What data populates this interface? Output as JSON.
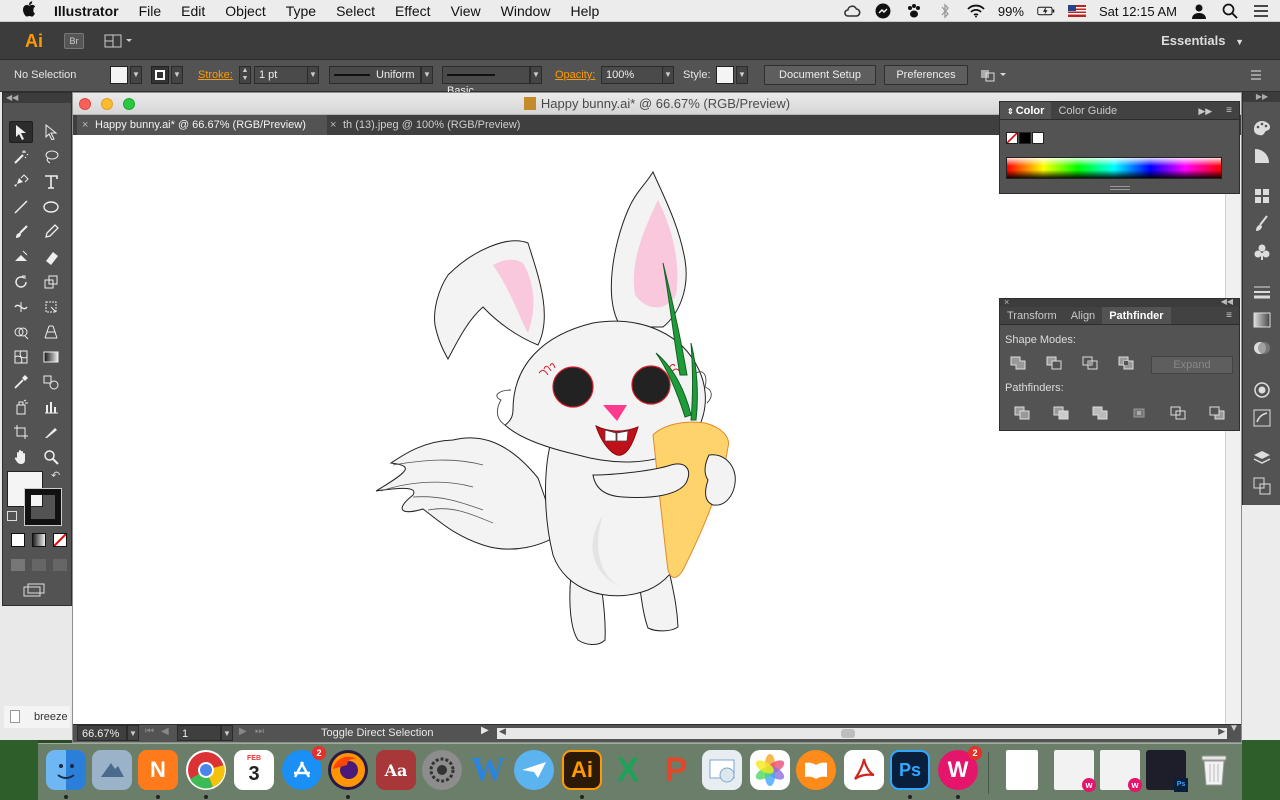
{
  "menubar": {
    "app_name": "Illustrator",
    "items": [
      "File",
      "Edit",
      "Object",
      "Type",
      "Select",
      "Effect",
      "View",
      "Window",
      "Help"
    ],
    "battery": "99%",
    "clock": "Sat 12:15 AM"
  },
  "appbar": {
    "logo": "Ai",
    "bridge": "Br",
    "workspace": "Essentials"
  },
  "control": {
    "selection": "No Selection",
    "stroke_label": "Stroke:",
    "stroke_weight": "1 pt",
    "profile": "Uniform",
    "brush": "Basic",
    "opacity_label": "Opacity:",
    "opacity": "100%",
    "style_label": "Style:",
    "document_setup": "Document Setup",
    "preferences": "Preferences"
  },
  "document": {
    "window_title": "Happy bunny.ai* @ 66.67% (RGB/Preview)",
    "tabs": [
      {
        "label": "Happy bunny.ai* @ 66.67% (RGB/Preview)"
      },
      {
        "label": "th (13).jpeg @ 100% (RGB/Preview)"
      }
    ],
    "zoom": "66.67%",
    "artboard": "1",
    "status": "Toggle Direct Selection"
  },
  "color_panel": {
    "tabs": [
      "Color",
      "Color Guide"
    ]
  },
  "pathfinder_panel": {
    "tabs": [
      "Transform",
      "Align",
      "Pathfinder"
    ],
    "shape_modes": "Shape Modes:",
    "expand": "Expand",
    "pathfinders": "Pathfinders:"
  },
  "desktop": {
    "file_label": "breeze"
  },
  "dock": {
    "badges": {
      "app_store": "2",
      "writer": "2"
    }
  },
  "colors": {
    "ui_dark": "#535353",
    "accent": "#ff9a00",
    "carrot": "#ffd36b",
    "ear_pink": "#f9c8dc",
    "nose": "#ff3b8d"
  }
}
